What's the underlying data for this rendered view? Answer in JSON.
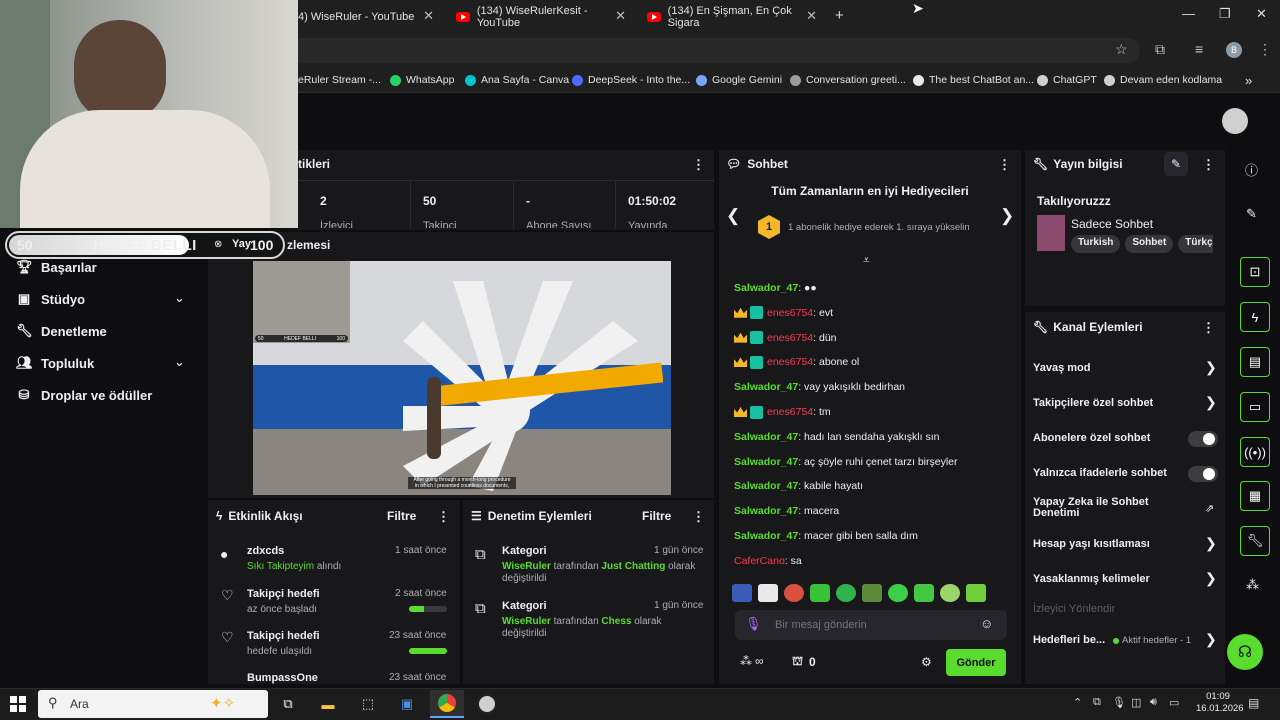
{
  "browser": {
    "tabs": [
      {
        "label": "4) WiseRuler - YouTube"
      },
      {
        "label": "(134) WiseRulerKesit - YouTube"
      },
      {
        "label": "(134) En Şişman, En Çok Sigara"
      }
    ],
    "bookmarks": [
      {
        "label": "eRuler Stream -..."
      },
      {
        "label": "WhatsApp"
      },
      {
        "label": "Ana Sayfa - Canva"
      },
      {
        "label": "DeepSeek - Into the..."
      },
      {
        "label": "Google Gemini"
      },
      {
        "label": "Conversation greeti..."
      },
      {
        "label": "The best ChatBot an..."
      },
      {
        "label": "ChatGPT"
      },
      {
        "label": "Devam eden kodlama"
      }
    ],
    "profile_letter": "B",
    "more_bookmarks": "»",
    "new_tab": "+"
  },
  "overlay": {
    "left_value": "50",
    "label": "HEDEF BELLI",
    "right_value": "100"
  },
  "nav": {
    "items": [
      {
        "label": "Başarılar"
      },
      {
        "label": "Stüdyo"
      },
      {
        "label": "Denetleme"
      },
      {
        "label": "Topluluk"
      },
      {
        "label": "Droplar ve ödüller"
      }
    ]
  },
  "stats": {
    "title": "tikleri",
    "cells": [
      {
        "value": "2",
        "label": "İzleyici"
      },
      {
        "value": "50",
        "label": "Takipçi"
      },
      {
        "value": "-",
        "label": "Abone Sayısı"
      },
      {
        "value": "01:50:02",
        "label": "Yayında"
      }
    ]
  },
  "preview": {
    "title": "Yayın önizlemesi",
    "title_visible": "zlemesi",
    "subtitle_line1": "After going through a month-long procedure",
    "subtitle_line2": "in which I presented countless documents,",
    "mini_label": "HEDEF BELLI",
    "mini_left": "50",
    "mini_right": "100"
  },
  "chat": {
    "title": "Sohbet",
    "hype_title": "Tüm Zamanların en iyi Hediyecileri",
    "hype_rank": "1",
    "hype_text": "1 abonelik hediye ederek 1. sıraya yükselin",
    "messages": [
      {
        "user": "Salwador_47",
        "text": ": ●●",
        "style": "green",
        "badges": false
      },
      {
        "user": "enes6754",
        "text": ": evt",
        "style": "red",
        "badges": true
      },
      {
        "user": "enes6754",
        "text": ": dün",
        "style": "red",
        "badges": true
      },
      {
        "user": "enes6754",
        "text": ": abone ol",
        "style": "red",
        "badges": true
      },
      {
        "user": "Salwador_47",
        "text": ": vay yakışıklı bedirhan",
        "style": "green",
        "badges": false
      },
      {
        "user": "enes6754",
        "text": ": tm",
        "style": "red",
        "badges": true
      },
      {
        "user": "Salwador_47",
        "text": ": hadı lan sendaha yakışklı sın",
        "style": "green",
        "badges": false
      },
      {
        "user": "Salwador_47",
        "text": ": aç şöyle ruhi çenet tarzı birşeyler",
        "style": "green",
        "badges": false
      },
      {
        "user": "Salwador_47",
        "text": ": kabile hayatı",
        "style": "green",
        "badges": false
      },
      {
        "user": "Salwador_47",
        "text": ": macera",
        "style": "green",
        "badges": false
      },
      {
        "user": "Salwador_47",
        "text": ": macer gibi ben salla dım",
        "style": "green",
        "badges": false
      },
      {
        "user": "CaferCano",
        "text": ": sa",
        "style": "red",
        "badges": false
      }
    ],
    "input_placeholder": "Bir mesaj gönderin",
    "points": "∞",
    "bits": "0",
    "send_label": "Gönder"
  },
  "stream_info": {
    "title": "Yayın bilgisi",
    "stream_title": "Takılıyoruzzz",
    "category": "Sadece Sohbet",
    "tags": [
      "Turkish",
      "Sohbet",
      "Türkçe"
    ]
  },
  "channel_actions": {
    "title": "Kanal Eylemleri",
    "items": [
      {
        "label": "Yavaş mod",
        "type": "chevron"
      },
      {
        "label": "Takipçilere özel sohbet",
        "type": "chevron"
      },
      {
        "label": "Abonelere özel sohbet",
        "type": "toggle"
      },
      {
        "label": "Yalnızca ifadelerle sohbet",
        "type": "toggle"
      },
      {
        "label": "Yapay Zeka ile Sohbet Denetimi",
        "type": "external"
      },
      {
        "label": "Hesap yaşı kısıtlaması",
        "type": "chevron"
      },
      {
        "label": "Yasaklanmış kelimeler",
        "type": "chevron"
      },
      {
        "label": "İzleyici Yönlendir",
        "type": "disabled"
      },
      {
        "label": "Hedefleri be...",
        "type": "chevron",
        "extra": "Aktif hedefler - 1"
      }
    ]
  },
  "activity": {
    "title": "Etkinlik Akışı",
    "filter_label": "Filtre",
    "items": [
      {
        "title": "zdxcds",
        "sub_highlight": "Sıkı Takipteyim",
        "sub": " alındı",
        "time": "1 saat önce"
      },
      {
        "title": "Takipçi hedefi",
        "sub": "az önce başladı",
        "time": "2 saat önce",
        "progress": 0.4
      },
      {
        "title": "Takipçi hedefi",
        "sub": "hedefe ulaşıldı",
        "time": "23 saat önce",
        "progress": 1.0
      },
      {
        "title": "BumpassOne",
        "sub": "",
        "time": "23 saat önce"
      }
    ]
  },
  "moderation": {
    "title": "Denetim Eylemleri",
    "filter_label": "Filtre",
    "items": [
      {
        "title": "Kategori",
        "user": "WiseRuler",
        "mid": " tarafından ",
        "cat": "Just Chatting",
        "end": " olarak değiştirildi",
        "time": "1 gün önce"
      },
      {
        "title": "Kategori",
        "user": "WiseRuler",
        "mid": " tarafından ",
        "cat": "Chess",
        "end": " olarak değiştirildi",
        "time": "1 gün önce"
      }
    ]
  },
  "taskbar": {
    "search_label": "Ara",
    "time": "01:09",
    "date": "16.01.2026"
  },
  "colors": {
    "accent_green": "#5adc2f",
    "twitch_red": "#ff3a4f",
    "panel_bg": "#18181b"
  }
}
